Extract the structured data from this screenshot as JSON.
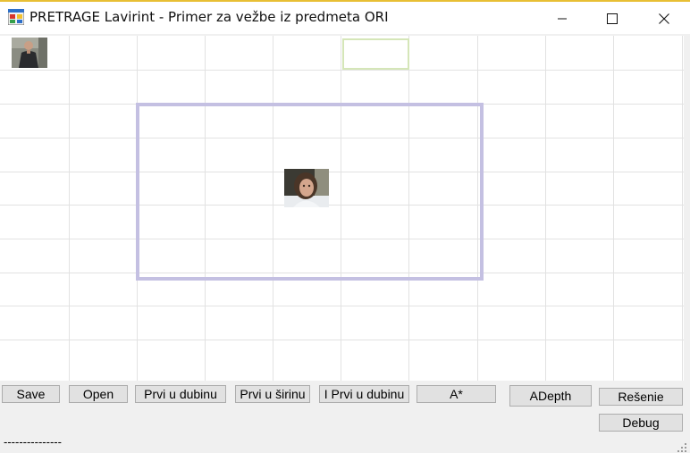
{
  "window": {
    "title": "PRETRAGE Lavirint - Primer za vežbe iz predmeta ORI",
    "icons": {
      "app": "form-app-icon",
      "minimize": "minimize-icon",
      "maximize": "maximize-icon",
      "close": "close-icon"
    }
  },
  "maze": {
    "start_image": "person-photo-start",
    "center_image": "person-photo-agent",
    "goal_color": "#d5e6b8",
    "viewport_color": "#c4c0e2",
    "grid_color": "#e2e2e2"
  },
  "buttons": {
    "save": "Save",
    "open": "Open",
    "dfs": "Prvi u dubinu",
    "bfs": "Prvi u širinu",
    "iterative_dfs": "I Prvi u dubinu",
    "astar": "A*",
    "adepth": "ADepth",
    "solution": "Rešenie",
    "debug": "Debug"
  },
  "status": {
    "text": "---------------"
  }
}
